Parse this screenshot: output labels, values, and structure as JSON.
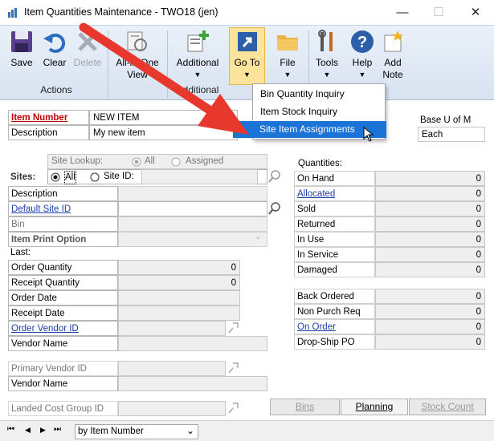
{
  "window": {
    "title": "Item Quantities Maintenance  -  TWO18 (jen)",
    "minimize": "—",
    "maximize": "☐",
    "close": "✕"
  },
  "ribbon": {
    "buttons": [
      {
        "label": "Save"
      },
      {
        "label": "Clear"
      },
      {
        "label": "Delete"
      },
      {
        "label1": "All-in-One",
        "label2": "View"
      },
      {
        "label": "Additional"
      },
      {
        "label": "Go To"
      },
      {
        "label": "File"
      },
      {
        "label": "Tools"
      },
      {
        "label": "Help"
      },
      {
        "label1": "Add",
        "label2": "Note"
      }
    ],
    "groups": {
      "actions": "Actions",
      "additional": "Additional"
    }
  },
  "menu": {
    "items": [
      "Bin Quantity Inquiry",
      "Item Stock Inquiry",
      "Site Item Assignments"
    ]
  },
  "form": {
    "item_number_label": "Item Number",
    "item_number": "NEW ITEM",
    "description_label": "Description",
    "description": "My new item",
    "base_uom_label": "Base U of M",
    "base_uom": "Each",
    "site_lookup_label": "Site Lookup:",
    "site_lookup_all": "All",
    "site_lookup_assigned": "Assigned",
    "sites_label": "Sites:",
    "sites_all": "All",
    "sites_siteid": "Site ID:",
    "left_rows": [
      {
        "label": "Description",
        "value": ""
      },
      {
        "label": "Default Site ID",
        "value": ""
      },
      {
        "label": "Bin",
        "value": ""
      },
      {
        "label": "Item Print Option",
        "value": ""
      }
    ],
    "last_label": "Last:",
    "last_rows": [
      {
        "label": "Order Quantity",
        "value": "0"
      },
      {
        "label": "Receipt Quantity",
        "value": "0"
      },
      {
        "label": "Order Date",
        "value": ""
      },
      {
        "label": "Receipt Date",
        "value": ""
      },
      {
        "label": "Order Vendor ID",
        "value": ""
      },
      {
        "label": "Vendor Name",
        "value": ""
      }
    ],
    "primary_vendor_label": "Primary Vendor ID",
    "vendor_name2_label": "Vendor Name",
    "landed_cost_label": "Landed Cost Group ID",
    "quantities_label": "Quantities:",
    "quantities": [
      {
        "label": "On Hand",
        "value": "0"
      },
      {
        "label": "Allocated",
        "value": "0"
      },
      {
        "label": "Sold",
        "value": "0"
      },
      {
        "label": "Returned",
        "value": "0"
      },
      {
        "label": "In Use",
        "value": "0"
      },
      {
        "label": "In Service",
        "value": "0"
      },
      {
        "label": "Damaged",
        "value": "0"
      }
    ],
    "quantities2": [
      {
        "label": "Back Ordered",
        "value": "0"
      },
      {
        "label": "Non Purch Req",
        "value": "0"
      },
      {
        "label": "On Order",
        "value": "0"
      },
      {
        "label": "Drop-Ship PO",
        "value": "0"
      }
    ],
    "buttons": {
      "bins": "Bins",
      "planning": "Planning",
      "stock_count": "Stock Count"
    }
  },
  "nav": {
    "sort": "by Item Number",
    "first": "⏮",
    "prev": "◀",
    "next": "▶",
    "last": "⏭"
  },
  "colors": {
    "arrow": "#e8372c",
    "menu_selected": "#1a73d6",
    "goto_highlight": "#fbe39b",
    "link": "#1d3fa8",
    "required": "#c00000"
  }
}
